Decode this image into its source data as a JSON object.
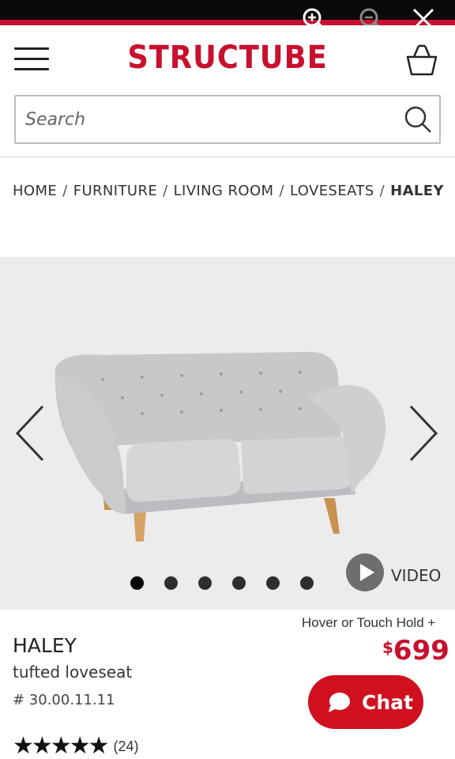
{
  "viewer": {
    "controls": [
      {
        "icon": "zoom-in-icon"
      },
      {
        "icon": "zoom-out-icon"
      },
      {
        "icon": "close-icon"
      }
    ]
  },
  "header": {
    "brand": "STRUCTUBE",
    "brand_color": "#c8102e",
    "menu_icon": "hamburger-menu-icon",
    "cart_icon": "shopping-basket-icon"
  },
  "search": {
    "placeholder": "Search",
    "value": "",
    "icon": "search-icon"
  },
  "breadcrumb": {
    "items": [
      "HOME",
      "FURNITURE",
      "LIVING ROOM",
      "LOVESEATS"
    ],
    "current": "HALEY",
    "separator": "/"
  },
  "gallery": {
    "image": "grey tufted loveseat with wooden legs",
    "slide_count": 6,
    "active_slide": 1,
    "video_label": "VIDEO",
    "prev_icon": "chevron-left-icon",
    "next_icon": "chevron-right-icon"
  },
  "product": {
    "hover_hint": "Hover or Touch Hold +",
    "name": "HALEY",
    "subtitle": "tufted loveseat",
    "sku": "# 30.00.11.11",
    "price_currency": "$",
    "price_amount": "699",
    "price_color": "#c8102e",
    "rating_stars": 5,
    "review_count": "(24)"
  },
  "chat": {
    "label": "Chat",
    "icon": "chat-bubble-icon",
    "color": "#d0101f"
  }
}
